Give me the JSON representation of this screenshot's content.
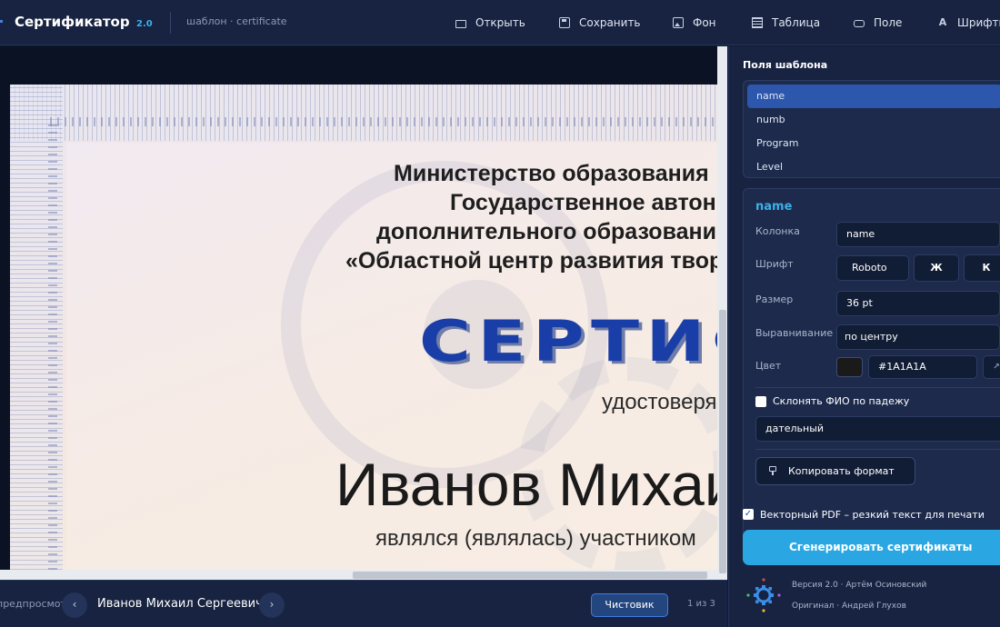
{
  "app": {
    "title": "Сертификатор",
    "version": "2.0",
    "template_label": "шаблон · certificate"
  },
  "toolbar": {
    "open": "Открыть",
    "save": "Сохранить",
    "background": "Фон",
    "table": "Таблица",
    "field": "Поле",
    "fonts": "Шрифты"
  },
  "icons": {
    "open": "folder-icon",
    "save": "save-icon",
    "background": "image-icon",
    "table": "table-icon",
    "field": "field-icon",
    "fonts": "font-icon"
  },
  "certificate": {
    "line1": "Министерство образования",
    "line2": "Государственное автон",
    "line3": "дополнительного образовани",
    "line4": "«Областной центр развития твор",
    "title": "СЕРТИФ",
    "certifies": "удостоверя",
    "recipient": "Иванов Михаи",
    "participation": "являлся (являлась) участником"
  },
  "preview": {
    "label": "предпросмотр",
    "prev": "‹",
    "next": "›",
    "name": "Иванов Михаил Сергеевич",
    "draft_button": "Чистовик",
    "page_count": "1 из 3"
  },
  "panel": {
    "fields_title": "Поля шаблона",
    "fields": [
      "name",
      "numb",
      "Program",
      "Level"
    ],
    "selected_field": "name",
    "props": {
      "title": "name",
      "column_label": "Колонка",
      "column_value": "name",
      "font_label": "Шрифт",
      "font_value": "Roboto",
      "bold_label": "Ж",
      "italic_label": "К",
      "size_label": "Размер",
      "size_value": "36 pt",
      "align_label": "Выравнивание",
      "align_value": "по центру",
      "color_label": "Цвет",
      "color_hex": "#1A1A1A",
      "color_extra": "↗",
      "decline_label": "Склонять ФИО по падежу",
      "case_value": "дательный",
      "copy_format": "Копировать формат"
    },
    "vector_pdf_label": "Векторный PDF – резкий текст для печати",
    "generate_button": "Сгенерировать сертификаты",
    "credits_line1": "Версия 2.0 · Артём Осиновский",
    "credits_line2": "Оригинал · Андрей Глухов"
  },
  "colors": {
    "accent": "#2aa6e2",
    "selected": "#2d56ad",
    "cert_title": "#1a3ea8",
    "text_color_swatch": "#1A1A1A"
  }
}
